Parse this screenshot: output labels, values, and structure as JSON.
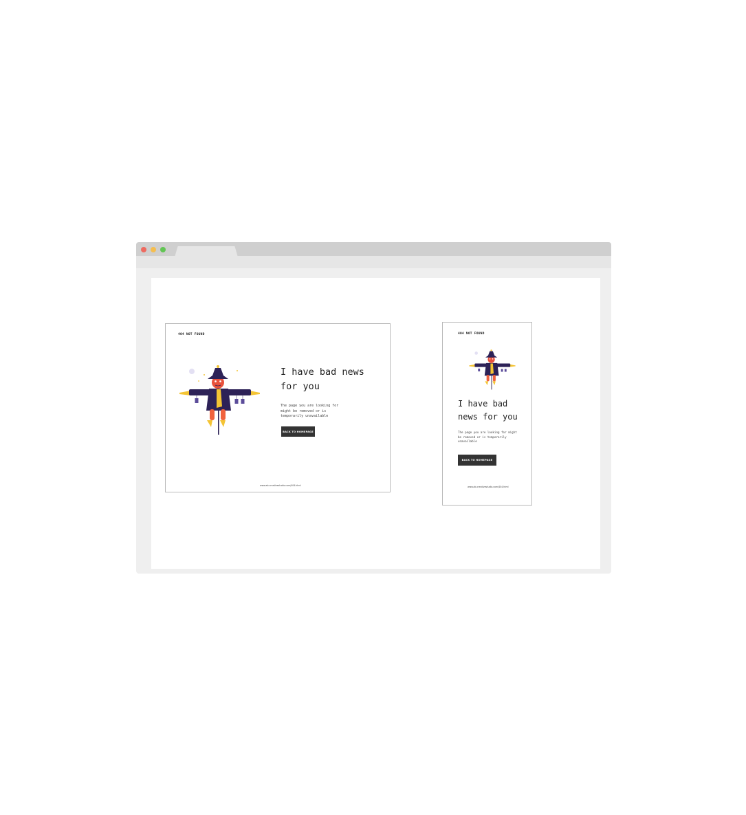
{
  "colors": {
    "window_frame": "#efefef",
    "titlebar": "#cfcfcf",
    "traffic_red": "#ee6a5f",
    "traffic_yellow": "#f5be4f",
    "traffic_green": "#62c554",
    "button_bg": "#333333",
    "scarecrow_hat": "#2d2257",
    "scarecrow_face": "#e8523c",
    "straw": "#f4c434",
    "pants": "#f0623e"
  },
  "desktop": {
    "brand": "404 NOT FOUND",
    "headline": "I have bad news for you",
    "body": "The page you are looking for might be removed or is temporarily unavailable",
    "cta": "BACK TO HOMEPAGE",
    "footer": "www.ab-creativestudio.com/404.html",
    "illustration_icon": "scarecrow-illustration"
  },
  "mobile": {
    "brand": "404 NOT FOUND",
    "headline": "I have bad news for you",
    "body": "The page you are looking for might be removed or is temporarily unavailable",
    "cta": "BACK TO HOMEPAGE",
    "footer": "www.ab-creativestudio.com/404.html",
    "illustration_icon": "scarecrow-illustration"
  }
}
